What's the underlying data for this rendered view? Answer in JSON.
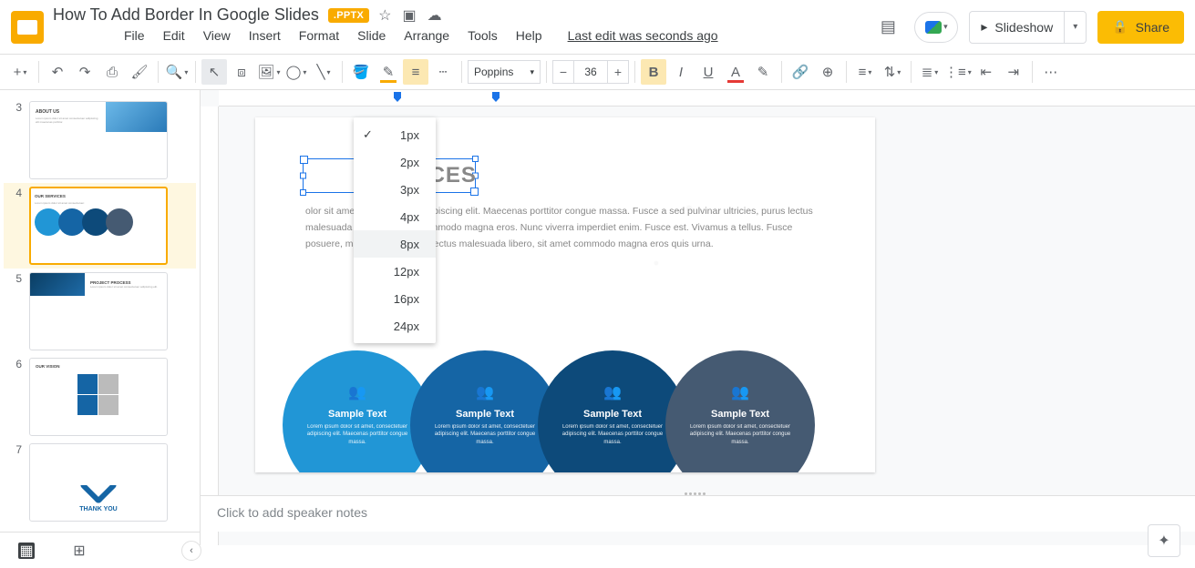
{
  "header": {
    "doc_title": "How To Add Border In Google Slides",
    "pptx_badge": ".PPTX",
    "slideshow_label": "Slideshow",
    "share_label": "Share"
  },
  "menu": {
    "items": [
      "File",
      "Edit",
      "View",
      "Insert",
      "Format",
      "Slide",
      "Arrange",
      "Tools",
      "Help"
    ],
    "last_edit": "Last edit was seconds ago"
  },
  "toolbar": {
    "font_name": "Poppins",
    "font_size": "36"
  },
  "border_weight_menu": {
    "options": [
      "1px",
      "2px",
      "3px",
      "4px",
      "8px",
      "12px",
      "16px",
      "24px"
    ],
    "checked": "1px",
    "hovered": "8px"
  },
  "thumbnails": [
    {
      "num": "3",
      "title": "ABOUT US"
    },
    {
      "num": "4",
      "title": "OUR SERVICES",
      "selected": true
    },
    {
      "num": "5",
      "title": "PROJECT PROCESS"
    },
    {
      "num": "6",
      "title": "OUR VISION"
    },
    {
      "num": "7",
      "title": "THANK YOU"
    }
  ],
  "slide": {
    "title_visible": "RVICES",
    "body": "olor sit amet, consectetuer adipiscing elit. Maecenas porttitor congue massa. Fusce a sed pulvinar ultricies, purus lectus malesuada libero, sit amet commodo magna eros. Nunc viverra imperdiet enim. Fusce est. Vivamus a tellus. Fusce posuere, magna ricies, purus lectus malesuada libero, sit amet commodo magna eros quis urna.",
    "circles": [
      {
        "title": "Sample Text",
        "text": "Lorem ipsum dolor sit amet, consectetuer adipiscing elit. Maecenas porttitor congue massa."
      },
      {
        "title": "Sample Text",
        "text": "Lorem ipsum dolor sit amet, consectetuer adipiscing elit. Maecenas porttitor congue massa."
      },
      {
        "title": "Sample Text",
        "text": "Lorem ipsum dolor sit amet, consectetuer adipiscing elit. Maecenas porttitor congue massa."
      },
      {
        "title": "Sample Text",
        "text": "Lorem ipsum dolor sit amet, consectetuer adipiscing elit. Maecenas porttitor congue massa."
      }
    ]
  },
  "notes_placeholder": "Click to add speaker notes"
}
